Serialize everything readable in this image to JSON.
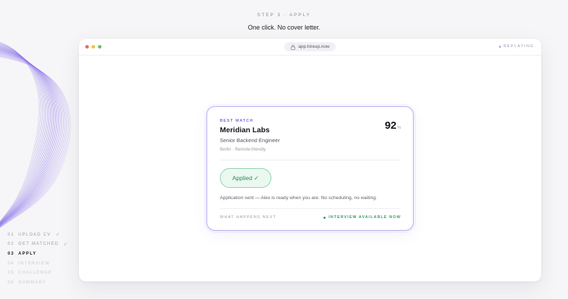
{
  "header": {
    "step_label": "STEP 3 · APPLY",
    "headline": "One click. No cover letter."
  },
  "browser": {
    "url": "app.hireup.now",
    "status": "REPLAYING"
  },
  "card": {
    "tag": "BEST MATCH",
    "company": "Meridian Labs",
    "role": "Senior Backend Engineer",
    "location": "Berlin · Remote-friendly",
    "score": "92",
    "score_unit": "%",
    "applied_label": "Applied ✓",
    "sent_message": "Application sent — Alex is ready when you are. No scheduling, no waiting.",
    "next_label": "WHAT HAPPENS NEXT",
    "next_status": "INTERVIEW AVAILABLE NOW"
  },
  "steps": [
    {
      "num": "01",
      "label": "UPLOAD CV",
      "check": "✓"
    },
    {
      "num": "02",
      "label": "GET MATCHED",
      "check": "✓"
    },
    {
      "num": "03",
      "label": "APPLY"
    },
    {
      "num": "04",
      "label": "INTERVIEW"
    },
    {
      "num": "05",
      "label": "CHALLENGE"
    },
    {
      "num": "06",
      "label": "SUMMARY"
    }
  ],
  "colors": {
    "accent": "#7a66df",
    "success": "#3a9a66",
    "background": "#f6f6f8"
  }
}
